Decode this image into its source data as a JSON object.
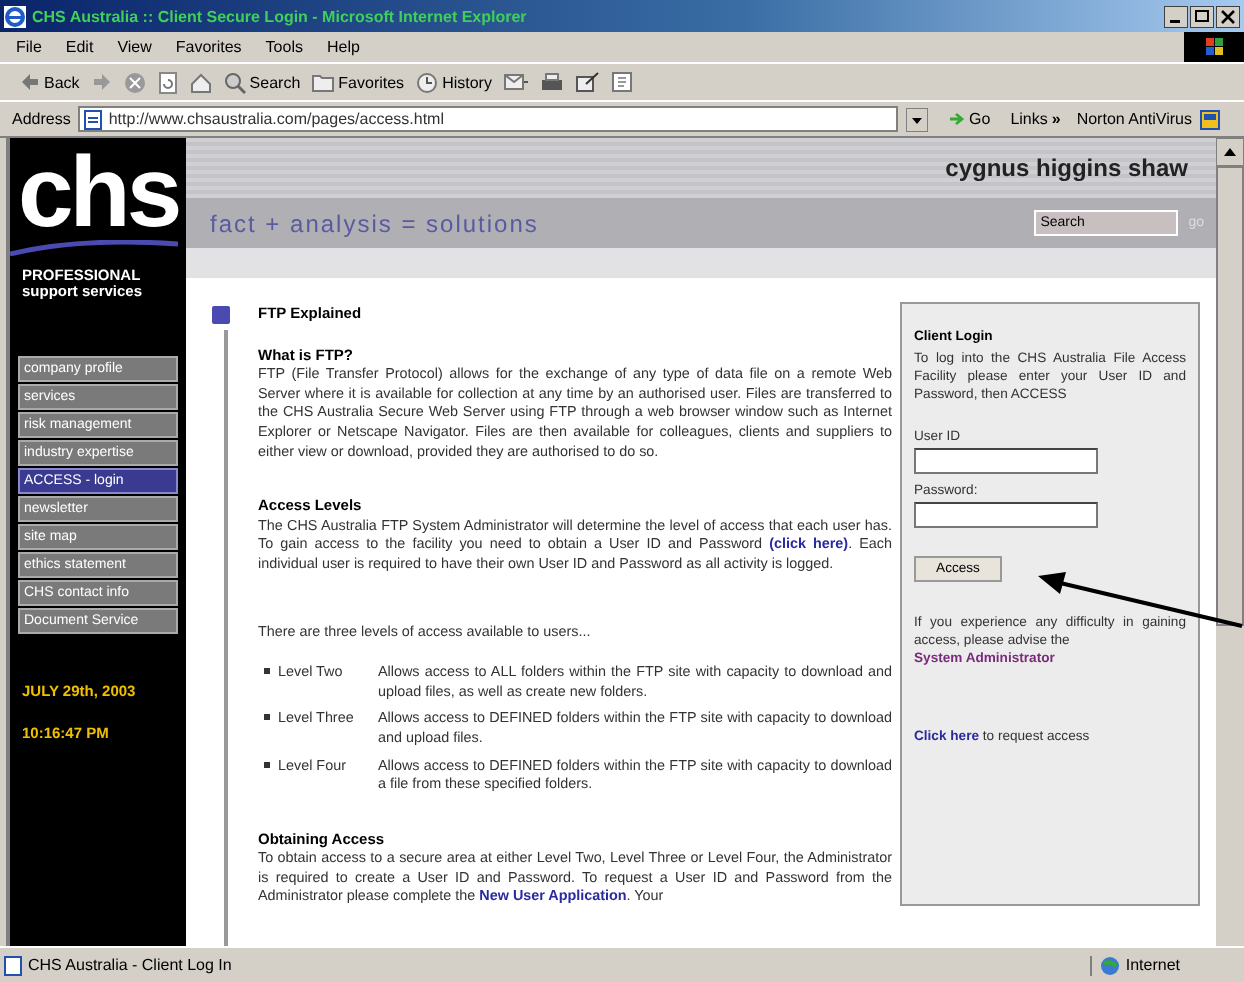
{
  "window": {
    "title": "CHS Australia :: Client Secure Login - Microsoft Internet Explorer"
  },
  "menu": [
    "File",
    "Edit",
    "View",
    "Favorites",
    "Tools",
    "Help"
  ],
  "toolbar": {
    "back": "Back",
    "search": "Search",
    "favorites": "Favorites",
    "history": "History"
  },
  "address": {
    "label": "Address",
    "url": "http://www.chsaustralia.com/pages/access.html",
    "go": "Go",
    "links": "Links",
    "links_more": "»",
    "addon": "Norton AntiVirus"
  },
  "site": {
    "logo": "chs",
    "logo_line1": "PROFESSIONAL",
    "logo_line2": "support services",
    "company": "cygnus higgins shaw",
    "tagline": "fact + analysis = solutions",
    "search": {
      "value": "Search"
    },
    "search_go": "go"
  },
  "nav": [
    {
      "label": "company profile",
      "selected": false
    },
    {
      "label": "services",
      "selected": false
    },
    {
      "label": "risk management",
      "selected": false
    },
    {
      "label": "industry expertise",
      "selected": false
    },
    {
      "label": "ACCESS - login",
      "selected": true
    },
    {
      "label": "newsletter",
      "selected": false
    },
    {
      "label": "site map",
      "selected": false
    },
    {
      "label": "ethics statement",
      "selected": false
    },
    {
      "label": "CHS contact info",
      "selected": false
    },
    {
      "label": "Document Service",
      "selected": false
    }
  ],
  "date": "JULY 29th, 2003",
  "time": "10:16:47 PM",
  "article": {
    "title": "FTP Explained",
    "sections": [
      {
        "heading": "What is FTP?",
        "parts": [
          {
            "text": "FTP (File Transfer Protocol) allows for the exchange of any type of data file on a remote Web Server where it is available for collection at any time by an authorised user. Files are transferred to the CHS Australia Secure Web Server using FTP through a web browser window such as Internet Explorer or Netscape Navigator. Files are then available for colleagues, clients and suppliers to either view or download, provided they are authorised to do so."
          }
        ]
      },
      {
        "heading": "Access Levels",
        "parts": [
          {
            "text": "The CHS Australia FTP System Administrator will determine the level of access that each user has. To gain access to the facility you need to obtain a User ID and Password "
          },
          {
            "link": "(click here)"
          },
          {
            "text": ". Each individual user is required to have their own User ID and Password as all activity is logged."
          }
        ]
      }
    ],
    "levels_intro": "There are three levels of access available to users...",
    "levels": [
      {
        "name": "Level Two",
        "text": "Allows access to ALL folders within the FTP site with capacity to download and upload files, as well as create new folders."
      },
      {
        "name": "Level Three",
        "text": "Allows access to DEFINED folders within the FTP site with capacity to download and upload files."
      },
      {
        "name": "Level Four",
        "text": "Allows access to DEFINED folders within the FTP site with capacity to download a file from these specified folders."
      }
    ],
    "obtaining": {
      "heading": "Obtaining Access",
      "parts": [
        {
          "text": "To obtain access to a secure area at either Level Two, Level Three or Level Four, the Administrator is required to create a User ID and Password. To request a User ID and Password from the Administrator please complete the "
        },
        {
          "link": "New User Application"
        },
        {
          "text": ". Your"
        }
      ]
    }
  },
  "login": {
    "title": "Client Login",
    "intro": "To log into the CHS Australia File Access Facility please enter your User ID and Password, then ACCESS",
    "user_label": "User ID",
    "password_label": "Password:",
    "button": "Access",
    "help_text": "If you experience any difficulty in gaining access, please advise the",
    "help_link": "System Administrator",
    "request_link": "Click here",
    "request_text": " to request access"
  },
  "status_bar": {
    "text": "CHS Australia - Client Log In",
    "zone": "Internet"
  }
}
